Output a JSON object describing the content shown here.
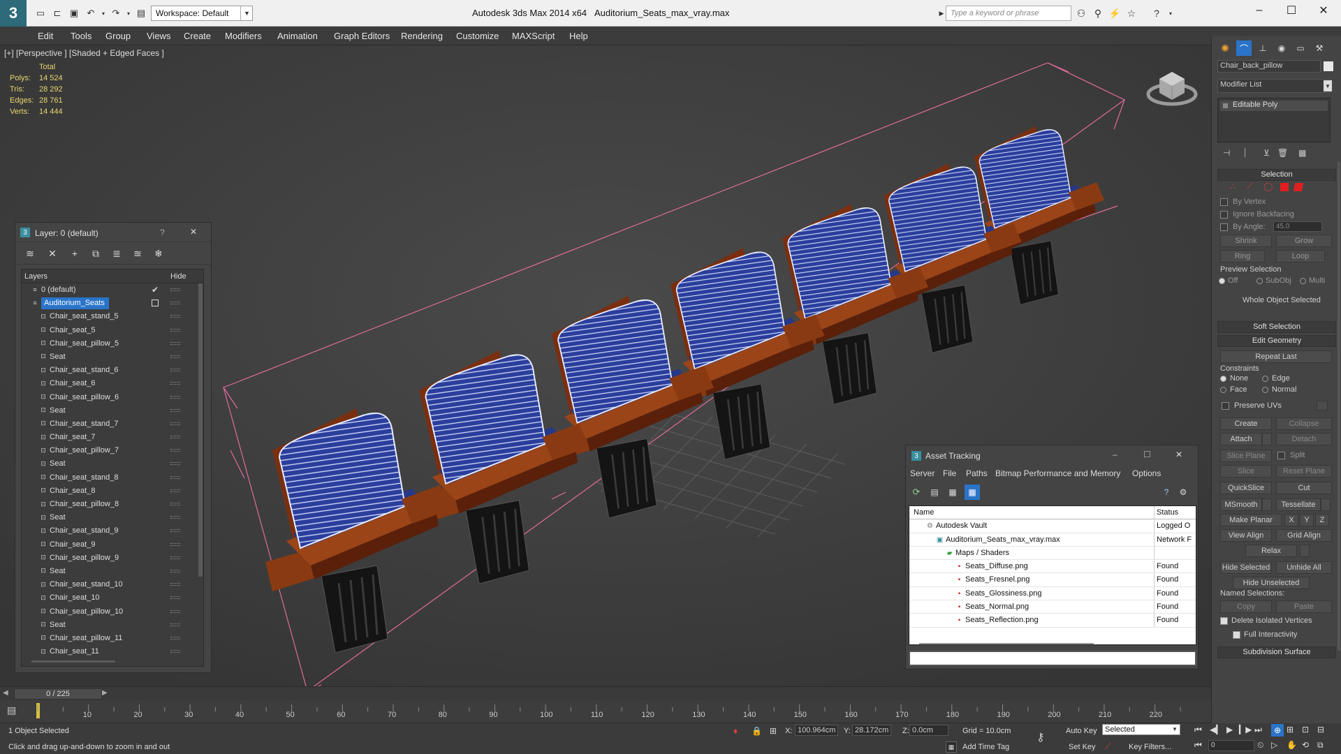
{
  "titlebar": {
    "workspace": "Workspace: Default",
    "app": "Autodesk 3ds Max  2014 x64",
    "file": "Auditorium_Seats_max_vray.max",
    "search_placeholder": "Type a keyword or phrase",
    "minimize": "–",
    "maximize": "☐",
    "close": "✕"
  },
  "menu": [
    "Edit",
    "Tools",
    "Group",
    "Views",
    "Create",
    "Modifiers",
    "Animation",
    "Graph Editors",
    "Rendering",
    "Customize",
    "MAXScript",
    "Help"
  ],
  "viewport": {
    "label": "[+] [Perspective ] [Shaded + Edged Faces ]",
    "stats": {
      "header": "Total",
      "rows": [
        {
          "label": "Polys:",
          "value": "14 524"
        },
        {
          "label": "Tris:",
          "value": "28 292"
        },
        {
          "label": "Edges:",
          "value": "28 761"
        },
        {
          "label": "Verts:",
          "value": "14 444"
        }
      ]
    }
  },
  "layer_window": {
    "title": "Layer: 0 (default)",
    "help": "?",
    "close": "✕",
    "col_layers": "Layers",
    "col_hide": "Hide",
    "rows": [
      {
        "name": "0 (default)",
        "indent": 1
      },
      {
        "name": "Auditorium_Seats",
        "indent": 1,
        "selected": true
      },
      {
        "name": "Chair_seat_stand_5",
        "indent": 2
      },
      {
        "name": "Chair_seat_5",
        "indent": 2
      },
      {
        "name": "Chair_seat_pillow_5",
        "indent": 2
      },
      {
        "name": "Seat",
        "indent": 2
      },
      {
        "name": "Chair_seat_stand_6",
        "indent": 2
      },
      {
        "name": "Chair_seat_6",
        "indent": 2
      },
      {
        "name": "Chair_seat_pillow_6",
        "indent": 2
      },
      {
        "name": "Seat",
        "indent": 2
      },
      {
        "name": "Chair_seat_stand_7",
        "indent": 2
      },
      {
        "name": "Chair_seat_7",
        "indent": 2
      },
      {
        "name": "Chair_seat_pillow_7",
        "indent": 2
      },
      {
        "name": "Seat",
        "indent": 2
      },
      {
        "name": "Chair_seat_stand_8",
        "indent": 2
      },
      {
        "name": "Chair_seat_8",
        "indent": 2
      },
      {
        "name": "Chair_seat_pillow_8",
        "indent": 2
      },
      {
        "name": "Seat",
        "indent": 2
      },
      {
        "name": "Chair_seat_stand_9",
        "indent": 2
      },
      {
        "name": "Chair_seat_9",
        "indent": 2
      },
      {
        "name": "Chair_seat_pillow_9",
        "indent": 2
      },
      {
        "name": "Seat",
        "indent": 2
      },
      {
        "name": "Chair_seat_stand_10",
        "indent": 2
      },
      {
        "name": "Chair_seat_10",
        "indent": 2
      },
      {
        "name": "Chair_seat_pillow_10",
        "indent": 2
      },
      {
        "name": "Seat",
        "indent": 2
      },
      {
        "name": "Chair_seat_pillow_11",
        "indent": 2
      },
      {
        "name": "Chair_seat_11",
        "indent": 2
      }
    ]
  },
  "asset_window": {
    "title": "Asset Tracking",
    "menu": [
      "Server",
      "File",
      "Paths",
      "Bitmap Performance and Memory",
      "Options"
    ],
    "col_name": "Name",
    "col_status": "Status",
    "rows": [
      {
        "name": "Autodesk Vault",
        "status": "Logged O",
        "indent": 1,
        "icon": "vault-icon"
      },
      {
        "name": "Auditorium_Seats_max_vray.max",
        "status": "Network F",
        "indent": 2,
        "icon": "max-file-icon"
      },
      {
        "name": "Maps / Shaders",
        "status": "",
        "indent": 3,
        "icon": "maps-icon"
      },
      {
        "name": "Seats_Diffuse.png",
        "status": "Found",
        "indent": 4,
        "icon": "png-icon"
      },
      {
        "name": "Seats_Fresnel.png",
        "status": "Found",
        "indent": 4,
        "icon": "png-icon"
      },
      {
        "name": "Seats_Glossiness.png",
        "status": "Found",
        "indent": 4,
        "icon": "png-icon"
      },
      {
        "name": "Seats_Normal.png",
        "status": "Found",
        "indent": 4,
        "icon": "png-icon"
      },
      {
        "name": "Seats_Reflection.png",
        "status": "Found",
        "indent": 4,
        "icon": "png-icon"
      }
    ]
  },
  "command_panel": {
    "object_name": "Chair_back_pillow",
    "modifier_list": "Modifier List",
    "stack_item": "Editable Poly",
    "selection_title": "Selection",
    "by_vertex": "By Vertex",
    "ignore_backfacing": "Ignore Backfacing",
    "by_angle": "By Angle:",
    "angle_value": "45.0",
    "shrink": "Shrink",
    "grow": "Grow",
    "ring": "Ring",
    "loop": "Loop",
    "preview_selection": "Preview Selection",
    "off": "Off",
    "subobj": "SubObj",
    "multi": "Multi",
    "whole_object": "Whole Object Selected",
    "soft_selection": "Soft Selection",
    "edit_geometry": "Edit Geometry",
    "repeat_last": "Repeat Last",
    "constraints": "Constraints",
    "none": "None",
    "edge": "Edge",
    "face": "Face",
    "normal": "Normal",
    "preserve_uvs": "Preserve UVs",
    "create": "Create",
    "collapse": "Collapse",
    "attach": "Attach",
    "detach": "Detach",
    "slice_plane": "Slice Plane",
    "split": "Split",
    "slice": "Slice",
    "reset_plane": "Reset Plane",
    "quickslice": "QuickSlice",
    "cut": "Cut",
    "msmooth": "MSmooth",
    "tessellate": "Tessellate",
    "make_planar": "Make Planar",
    "x": "X",
    "y": "Y",
    "z": "Z",
    "view_align": "View Align",
    "grid_align": "Grid Align",
    "relax": "Relax",
    "hide_selected": "Hide Selected",
    "unhide_all": "Unhide All",
    "hide_unselected": "Hide Unselected",
    "named_selections": "Named Selections:",
    "copy": "Copy",
    "paste": "Paste",
    "delete_isolated": "Delete Isolated Vertices",
    "full_interactivity": "Full Interactivity",
    "subdivision_surface": "Subdivision Surface"
  },
  "timeline": {
    "frame": "0 / 225",
    "ticks": [
      "10",
      "20",
      "30",
      "40",
      "50",
      "60",
      "70",
      "80",
      "90",
      "100",
      "110",
      "120",
      "130",
      "140",
      "150",
      "160",
      "170",
      "180",
      "190",
      "200",
      "210",
      "220"
    ]
  },
  "status": {
    "selected": "1 Object Selected",
    "hint": "Click and drag up-and-down to zoom in and out",
    "x_label": "X:",
    "x_value": "100.964cm",
    "y_label": "Y:",
    "y_value": "28.172cm",
    "z_label": "Z:",
    "z_value": "0.0cm",
    "grid": "Grid = 10.0cm",
    "add_time_tag": "Add Time Tag",
    "auto_key": "Auto Key",
    "set_key": "Set Key",
    "key_mode": "Selected",
    "key_filters": "Key Filters...",
    "frame_field": "0"
  }
}
